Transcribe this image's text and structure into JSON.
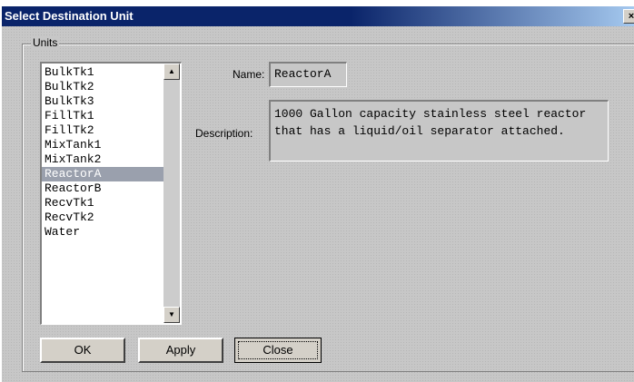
{
  "window": {
    "title": "Select Destination Unit",
    "close_glyph": "×"
  },
  "units_group": {
    "label": "Units"
  },
  "units_list": {
    "items": [
      "BulkTk1",
      "BulkTk2",
      "BulkTk3",
      "FillTk1",
      "FillTk2",
      "MixTank1",
      "MixTank2",
      "ReactorA",
      "ReactorB",
      "RecvTk1",
      "RecvTk2",
      "Water"
    ],
    "selected": "ReactorA"
  },
  "details": {
    "name_label": "Name:",
    "name_value": "ReactorA",
    "description_label": "Description:",
    "description_value": "1000 Gallon capacity stainless steel reactor that has a liquid/oil separator attached."
  },
  "buttons": {
    "ok": "OK",
    "apply": "Apply",
    "close": "Close"
  },
  "icons": {
    "scroll_up": "scroll-up-arrow-icon",
    "scroll_down": "scroll-down-arrow-icon"
  }
}
